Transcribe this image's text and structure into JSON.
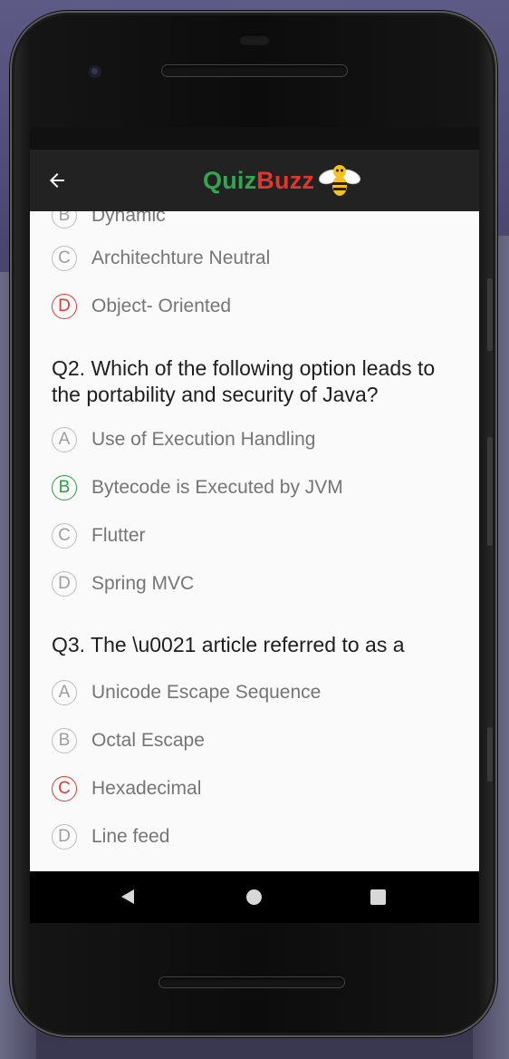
{
  "app": {
    "title_part1": "Quiz",
    "title_part2": "Buzz",
    "mascot_icon": "bee-icon"
  },
  "colors": {
    "appbar": "#222222",
    "quiz_green": "#2fa84f",
    "buzz_red": "#e4352c",
    "wrong_red": "#e53935",
    "correct_green": "#2e9d48",
    "fab_blue": "#2196f3"
  },
  "q1": {
    "options": [
      {
        "letter": "B",
        "text": "Dynamic"
      },
      {
        "letter": "C",
        "text": "Architechture Neutral"
      },
      {
        "letter": "D",
        "text": "Object- Oriented",
        "state": "wrong"
      }
    ]
  },
  "q2": {
    "question": "Q2.  Which of the following option leads to the portability and security of Java?",
    "options": [
      {
        "letter": "A",
        "text": "Use of Execution Handling"
      },
      {
        "letter": "B",
        "text": "Bytecode is Executed by JVM",
        "state": "correct"
      },
      {
        "letter": "C",
        "text": "Flutter"
      },
      {
        "letter": "D",
        "text": "Spring MVC"
      }
    ]
  },
  "q3": {
    "question": "Q3.  The \\u0021 article referred to as a",
    "options": [
      {
        "letter": "A",
        "text": "Unicode Escape Sequence"
      },
      {
        "letter": "B",
        "text": "Octal Escape"
      },
      {
        "letter": "C",
        "text": "Hexadecimal",
        "state": "wrong"
      },
      {
        "letter": "D",
        "text": "Line feed"
      }
    ]
  },
  "fab": {
    "icon": "check-icon"
  },
  "navbar": {
    "icons": [
      "back-triangle-icon",
      "home-circle-icon",
      "recents-square-icon"
    ]
  }
}
